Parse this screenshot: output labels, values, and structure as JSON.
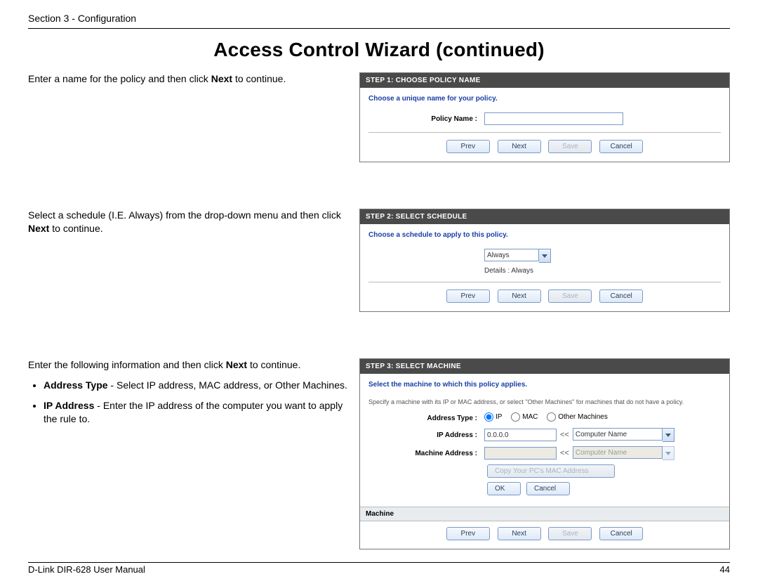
{
  "header": {
    "section": "Section 3 - Configuration"
  },
  "title": "Access Control Wizard (continued)",
  "footer": {
    "manual": "D-Link DIR-628 User Manual",
    "page": "44"
  },
  "blocks": {
    "one": {
      "text_pre": "Enter a name for the policy and then click ",
      "bold": "Next",
      "text_post": " to continue.",
      "panel": {
        "header": "STEP 1: CHOOSE POLICY NAME",
        "intro": "Choose a unique name for your policy.",
        "label": "Policy Name :",
        "value": "",
        "buttons": {
          "prev": "Prev",
          "next": "Next",
          "save": "Save",
          "cancel": "Cancel"
        }
      }
    },
    "two": {
      "text_pre": "Select a schedule (I.E. Always) from the drop-down menu and then click ",
      "bold": "Next",
      "text_post": " to continue.",
      "panel": {
        "header": "STEP 2: SELECT SCHEDULE",
        "intro": "Choose a schedule to apply to this policy.",
        "select": "Always",
        "details_label": "Details :",
        "details_value": "Always",
        "buttons": {
          "prev": "Prev",
          "next": "Next",
          "save": "Save",
          "cancel": "Cancel"
        }
      }
    },
    "three": {
      "text_pre": "Enter the following information and then click ",
      "bold": "Next",
      "text_post": " to continue.",
      "bullets": {
        "addrtype_b": "Address Type",
        "addrtype_t": " - Select IP address, MAC address, or Other Machines.",
        "ip_b": "IP Address",
        "ip_t": " - Enter the IP address of the computer you want to apply the rule to."
      },
      "panel": {
        "header": "STEP 3: SELECT MACHINE",
        "intro": "Select the machine to which this policy applies.",
        "note": "Specify a machine with its IP or MAC address, or select \"Other Machines\" for machines that do not have a policy.",
        "labels": {
          "address_type": "Address Type :",
          "ip_address": "IP Address :",
          "machine_address": "Machine Address :"
        },
        "radios": {
          "ip": "IP",
          "mac": "MAC",
          "other": "Other Machines"
        },
        "ip_value": "0.0.0.0",
        "lt": "<<",
        "combo1": "Computer Name",
        "combo2": "Computer Name",
        "copy_btn": "Copy Your PC's MAC Address",
        "ok": "OK",
        "cancel_small": "Cancel",
        "sub": "Machine",
        "buttons": {
          "prev": "Prev",
          "next": "Next",
          "save": "Save",
          "cancel": "Cancel"
        }
      }
    }
  }
}
